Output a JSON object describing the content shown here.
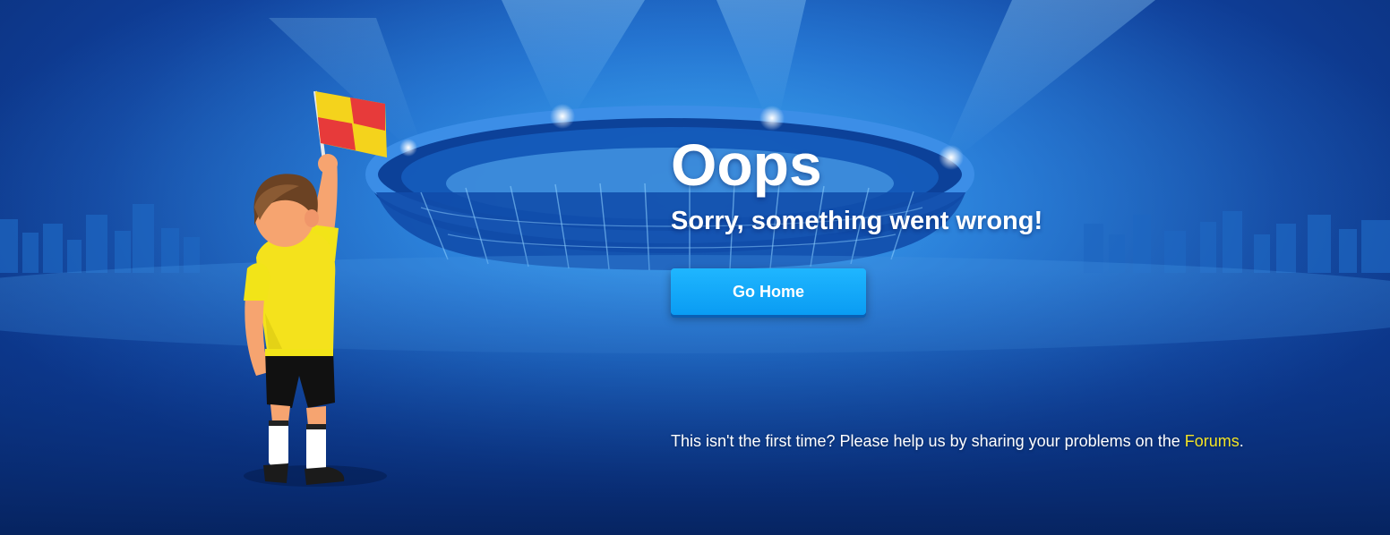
{
  "error": {
    "title": "Oops",
    "subtitle": "Sorry, something went wrong!",
    "home_button": "Go Home",
    "help_prefix": "This isn't the first time? Please help us by sharing your problems on the ",
    "forums_link": "Forums",
    "help_suffix": "."
  },
  "colors": {
    "button": "#0a9cf3",
    "link": "#f2e426",
    "background": "#1a62c4"
  }
}
